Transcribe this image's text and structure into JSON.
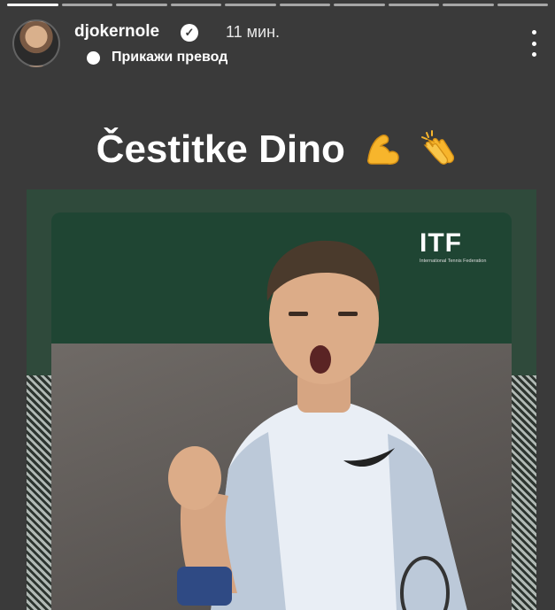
{
  "story": {
    "progress_segments": 10,
    "active_segment": 0
  },
  "header": {
    "username": "djokernole",
    "verified_icon": "verified-check-icon",
    "time": "11 мин.",
    "translate_label": "Прикажи превод",
    "more_icon": "more-vertical-icon"
  },
  "caption": {
    "text": "Čestitke Dino",
    "emojis": [
      "flexed-biceps-emoji",
      "clapping-hands-emoji"
    ]
  },
  "media": {
    "logo_text": "ITF",
    "logo_subtext": "International Tennis Federation"
  },
  "colors": {
    "background": "#3a3a3a",
    "card_green": "#2f4a3b",
    "emoji_yellow": "#f7b52c"
  }
}
